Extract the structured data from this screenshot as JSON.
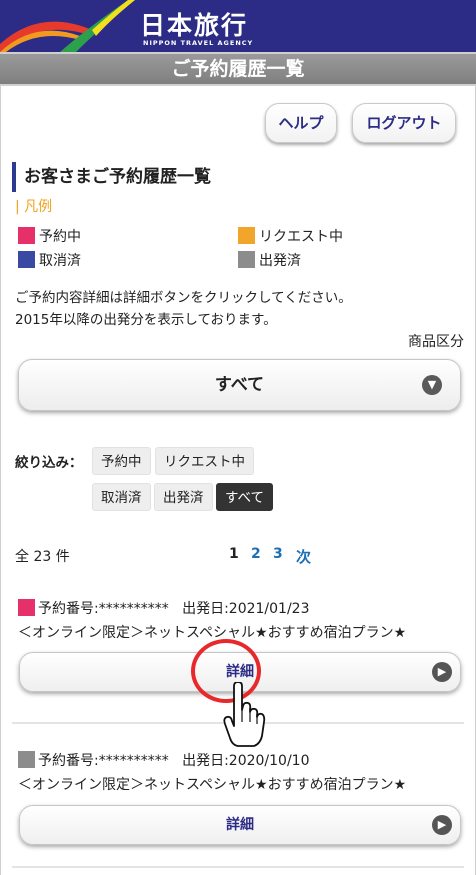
{
  "header": {
    "brand_name": "日本旅行",
    "brand_sub": "NIPPON TRAVEL AGENCY",
    "page_title": "ご予約履歴一覧"
  },
  "top_buttons": {
    "help": "ヘルプ",
    "logout": "ログアウト"
  },
  "section_title": "お客さまご予約履歴一覧",
  "legend": {
    "label": "凡例",
    "items": [
      {
        "label": "予約中",
        "color": "#e5306a"
      },
      {
        "label": "リクエスト中",
        "color": "#f2a52b"
      },
      {
        "label": "取消済",
        "color": "#3a4aa3"
      },
      {
        "label": "出発済",
        "color": "#8c8c8c"
      }
    ]
  },
  "info_text": {
    "line1": "ご予約内容詳細は詳細ボタンをクリックしてください。",
    "line2": "2015年以降の出発分を表示しております。"
  },
  "category": {
    "label": "商品区分",
    "selected": "すべて"
  },
  "filter": {
    "label": "絞り込み：",
    "options": [
      "予約中",
      "リクエスト中",
      "取消済",
      "出発済",
      "すべて"
    ],
    "active": "すべて"
  },
  "pagination": {
    "total": "全 23 件",
    "current": "1",
    "page2": "2",
    "page3": "3",
    "next": "次"
  },
  "results": [
    {
      "status_color": "#e5306a",
      "number_label": "予約番号:**********",
      "departure": "出発日:2021/01/23",
      "plan": "＜オンライン限定＞ネットスペシャル★おすすめ宿泊プラン★",
      "detail_label": "詳細"
    },
    {
      "status_color": "#8c8c8c",
      "number_label": "予約番号:**********",
      "departure": "出発日:2020/10/10",
      "plan": "＜オンライン限定＞ネットスペシャル★おすすめ宿泊プラン★",
      "detail_label": "詳細"
    }
  ],
  "colors": {
    "header_bg": "#2c2c86",
    "accent_red": "#e8282b",
    "link_blue": "#1f6fb5"
  }
}
